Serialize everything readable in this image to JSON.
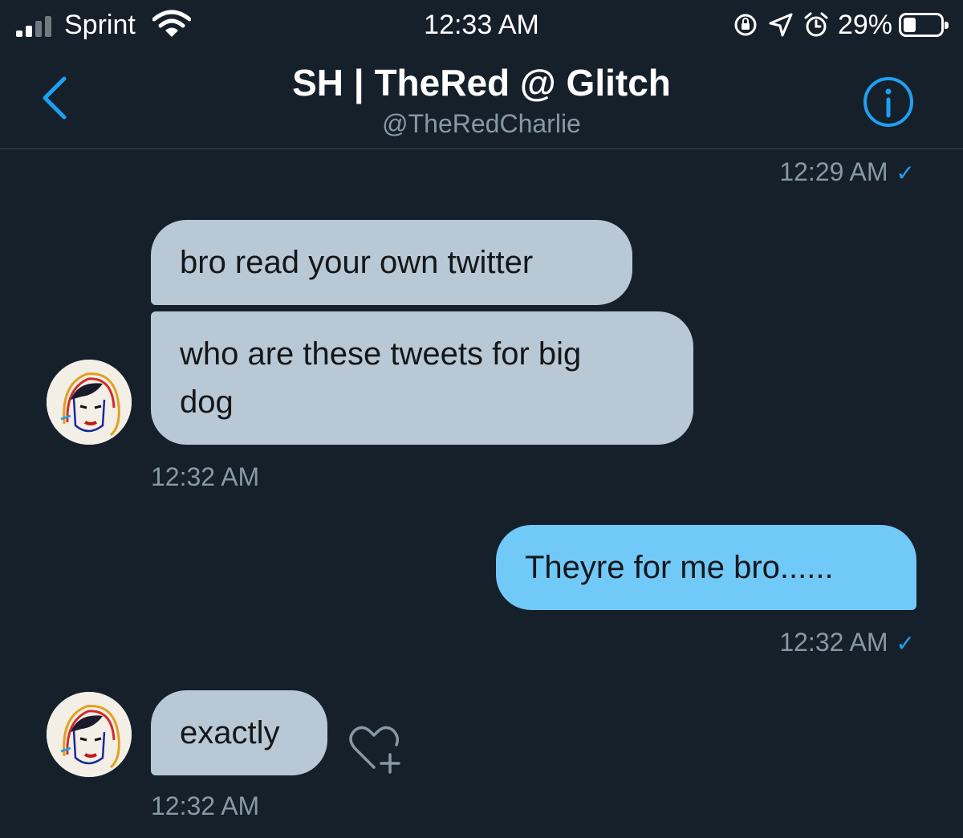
{
  "status_bar": {
    "carrier": "Sprint",
    "time": "12:33 AM",
    "battery_percent": "29%",
    "battery_level": 0.29,
    "icons": [
      "cellular-signal-icon",
      "wifi-icon",
      "orientation-lock-icon",
      "location-arrow-icon",
      "alarm-icon",
      "battery-icon"
    ]
  },
  "header": {
    "title": "SH | TheRed @ Glitch",
    "handle": "@TheRedCharlie",
    "back_icon": "chevron-left-icon",
    "info_icon": "info-icon"
  },
  "colors": {
    "background": "#15202b",
    "received_bubble": "#b8c9d5",
    "sent_bubble": "#71c9f8",
    "accent": "#1da1f2",
    "secondary_text": "#8899a6"
  },
  "messages": {
    "top_timestamp": "12:29 AM",
    "received_1": {
      "line_1": "bro read your own twitter",
      "line_2a": "who are these tweets for big",
      "line_2b": "dog",
      "timestamp": "12:32 AM"
    },
    "sent_1": {
      "text": "Theyre for me bro......",
      "timestamp": "12:32 AM"
    },
    "received_2": {
      "text": "exactly",
      "timestamp": "12:32 AM"
    },
    "read_check": "✓"
  }
}
